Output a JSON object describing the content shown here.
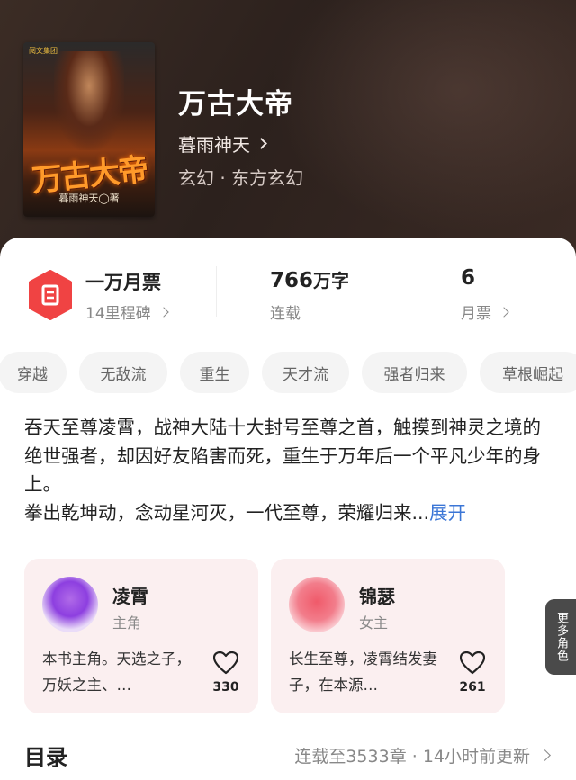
{
  "book": {
    "cover_title": "万古大帝",
    "cover_author": "暮雨神天◯著",
    "cover_badge": "阅文集团",
    "title": "万古大帝",
    "author": "暮雨神天",
    "genre": "玄幻 · 东方玄幻"
  },
  "stats": {
    "ticket": {
      "main": "一万月票",
      "sub": "14里程碑"
    },
    "words": {
      "value": "766",
      "unit": "万字",
      "sub": "连载"
    },
    "monthly": {
      "value": "6",
      "sub": "月票"
    }
  },
  "tags": [
    "穿越",
    "无敌流",
    "重生",
    "天才流",
    "强者归来",
    "草根崛起"
  ],
  "description": {
    "p1": "吞天至尊凌霄，战神大陆十大封号至尊之首，触摸到神灵之境的绝世强者，却因好友陷害而死，重生于万年后一个平凡少年的身上。",
    "p2": "拳出乾坤动，念动星河灭，一代至尊，荣耀归来...",
    "expand": "展开"
  },
  "roles": [
    {
      "name": "凌霄",
      "type": "主角",
      "desc": "本书主角。天选之子，万妖之主、…",
      "likes": "330"
    },
    {
      "name": "锦瑟",
      "type": "女主",
      "desc": "长生至尊，凌霄结发妻子，在本源…",
      "likes": "261"
    }
  ],
  "more_roles": "更多角色",
  "toc": {
    "title": "目录",
    "info": "连载至3533章 · 14小时前更新"
  },
  "colors": {
    "accent_red": "#f04343",
    "link_blue": "#3b76d6",
    "card_bg": "#fbeff0"
  }
}
